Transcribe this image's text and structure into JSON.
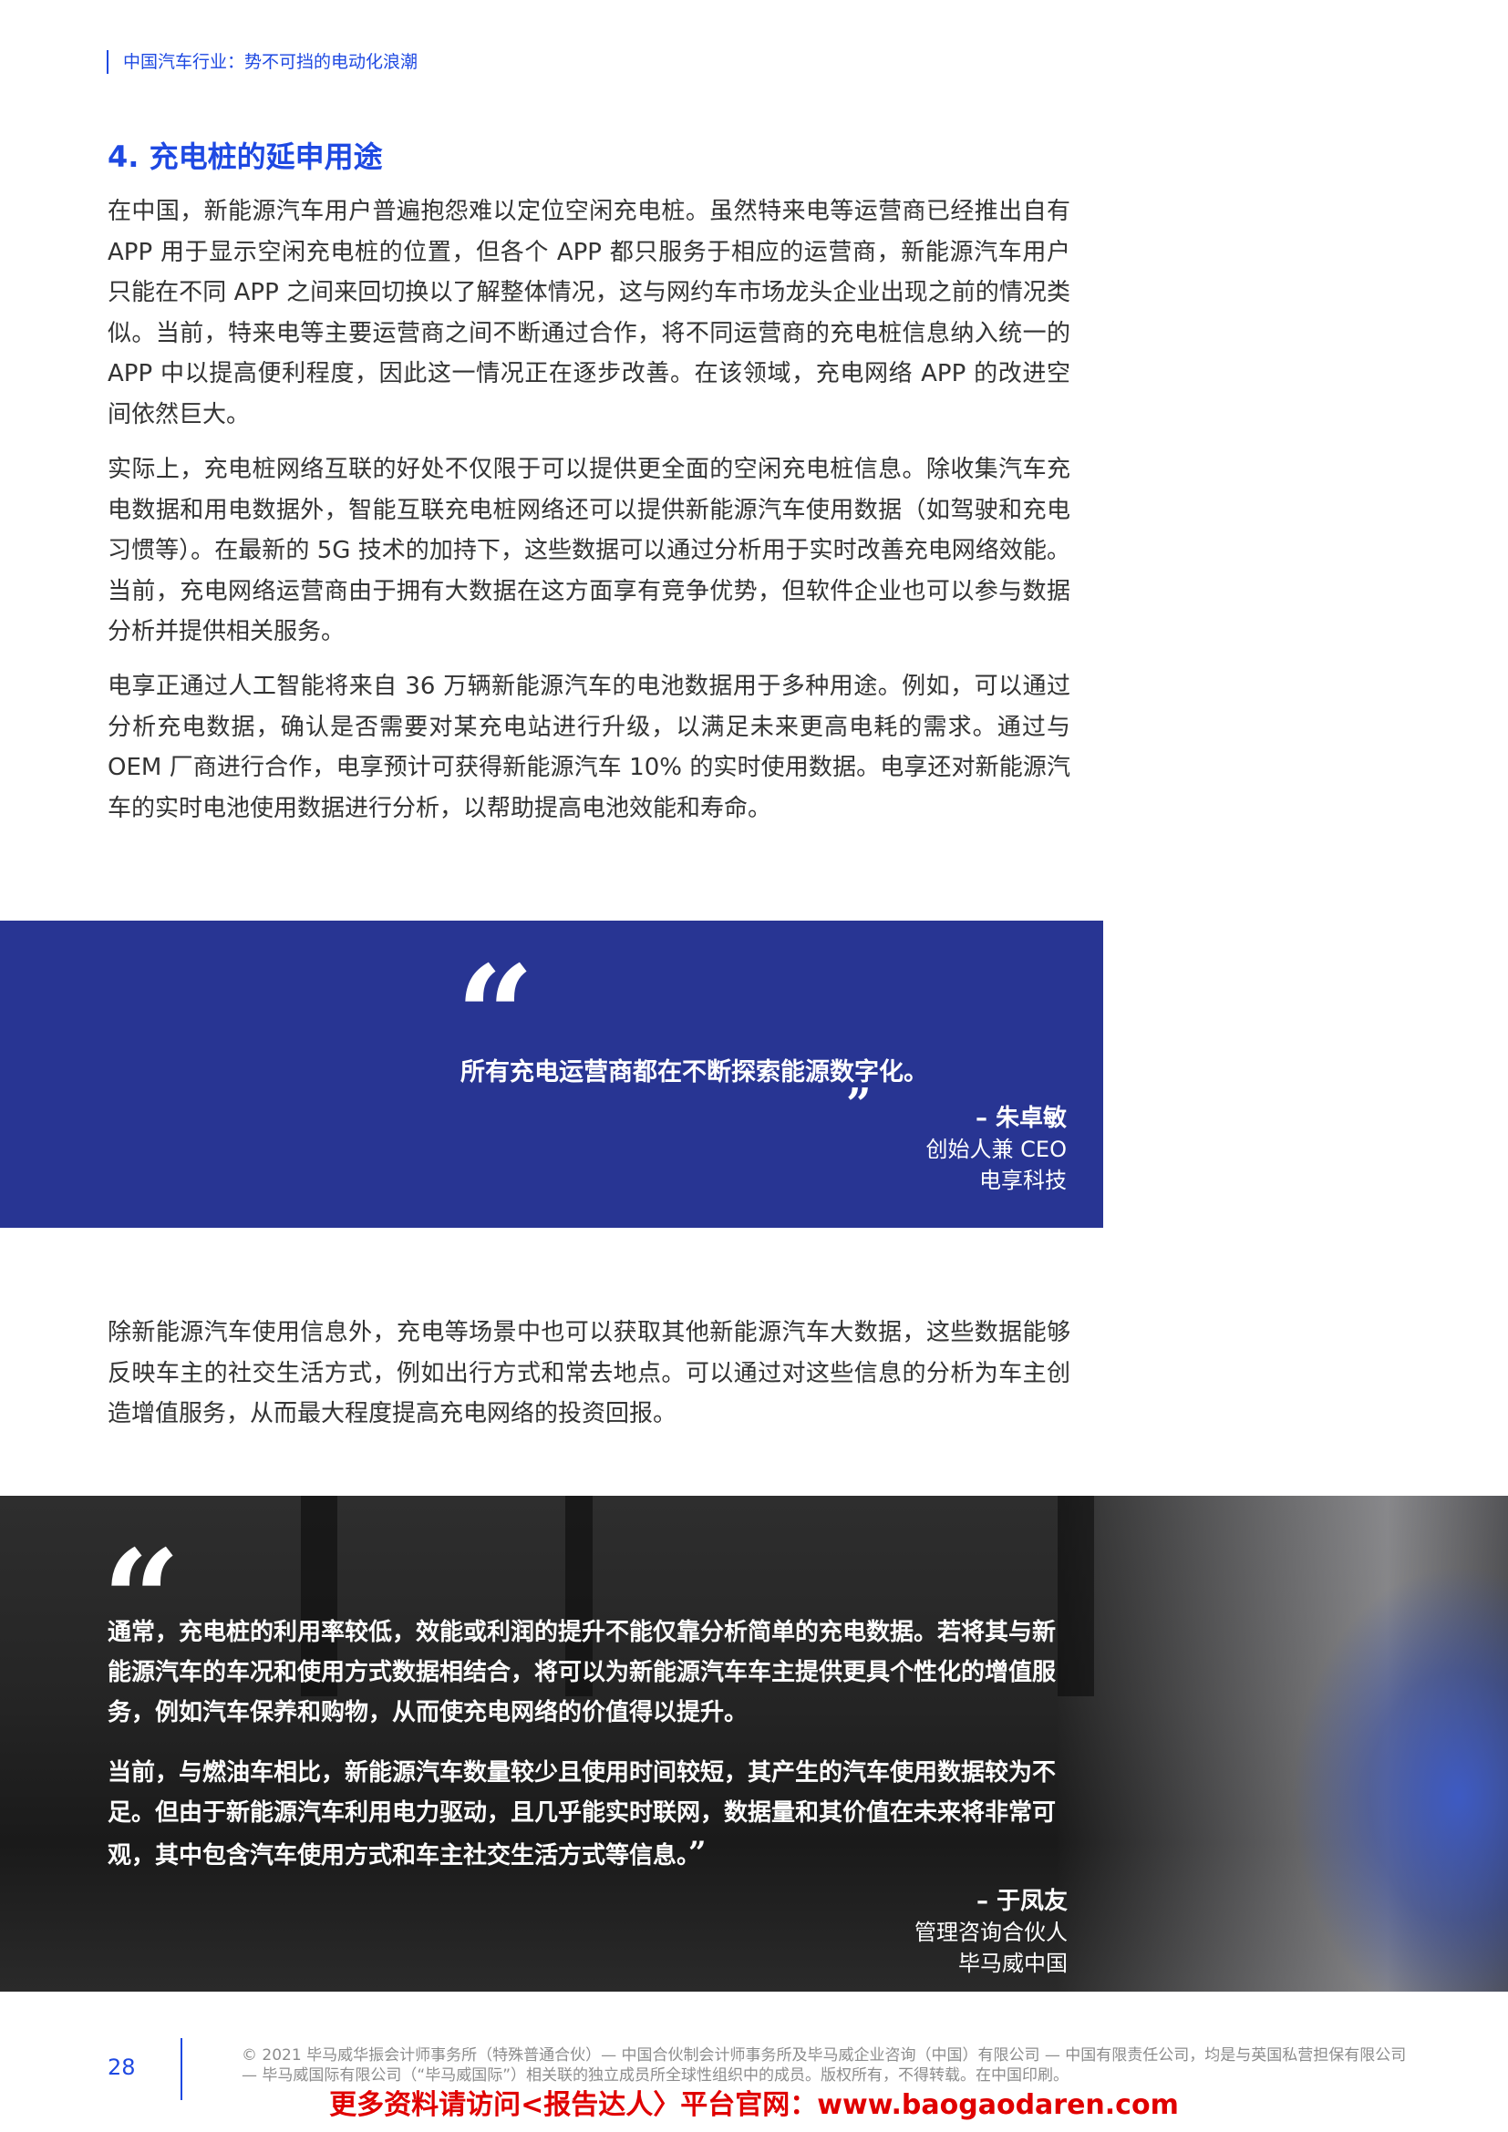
{
  "header": {
    "title": "中国汽车行业：势不可挡的电动化浪潮"
  },
  "section": {
    "title": "4. 充电桩的延申用途"
  },
  "paragraphs": [
    "在中国，新能源汽车用户普遍抱怨难以定位空闲充电桩。虽然特来电等运营商已经推出自有 APP 用于显示空闲充电桩的位置，但各个 APP 都只服务于相应的运营商，新能源汽车用户只能在不同 APP 之间来回切换以了解整体情况，这与网约车市场龙头企业出现之前的情况类似。当前，特来电等主要运营商之间不断通过合作，将不同运营商的充电桩信息纳入统一的 APP 中以提高便利程度，因此这一情况正在逐步改善。在该领域，充电网络 APP 的改进空间依然巨大。",
    "实际上，充电桩网络互联的好处不仅限于可以提供更全面的空闲充电桩信息。除收集汽车充电数据和用电数据外，智能互联充电桩网络还可以提供新能源汽车使用数据（如驾驶和充电习惯等）。在最新的 5G 技术的加持下，这些数据可以通过分析用于实时改善充电网络效能。当前，充电网络运营商由于拥有大数据在这方面享有竞争优势，但软件企业也可以参与数据分析并提供相关服务。",
    "电享正通过人工智能将来自 36 万辆新能源汽车的电池数据用于多种用途。例如，可以通过分析充电数据，确认是否需要对某充电站进行升级，以满足未来更高电耗的需求。通过与 OEM 厂商进行合作，电享预计可获得新能源汽车 10% 的实时使用数据。电享还对新能源汽车的实时电池使用数据进行分析，以帮助提高电池效能和寿命。",
    "除新能源汽车使用信息外，充电等场景中也可以获取其他新能源汽车大数据，这些数据能够反映车主的社交生活方式，例如出行方式和常去地点。可以通过对这些信息的分析为车主创造增值服务，从而最大程度提高充电网络的投资回报。"
  ],
  "quote1": {
    "open_mark": "“",
    "text": "所有充电运营商都在不断探索能源数字化。",
    "close_mark": "”",
    "name": "– 朱卓敏",
    "title": "创始人兼 CEO",
    "company": "电享科技"
  },
  "quote2": {
    "open_mark": "“",
    "text1": "通常，充电桩的利用率较低，效能或利润的提升不能仅靠分析简单的充电数据。若将其与新能源汽车的车况和使用方式数据相结合，将可以为新能源汽车车主提供更具个性化的增值服务，例如汽车保养和购物，从而使充电网络的价值得以提升。",
    "text2": "当前，与燃油车相比，新能源汽车数量较少且使用时间较短，其产生的汽车使用数据较为不足。但由于新能源汽车利用电力驱动，且几乎能实时联网，数据量和其价值在未来将非常可观，其中包含汽车使用方式和车主社交生活方式等信息。",
    "close_mark": "”",
    "name": "– 于凤友",
    "title": "管理咨询合伙人",
    "company": "毕马威中国"
  },
  "footer": {
    "page_number": "28",
    "copyright": "© 2021 毕马威华振会计师事务所（特殊普通合伙）— 中国合伙制会计师事务所及毕马威企业咨询（中国）有限公司 — 中国有限责任公司，均是与英国私营担保有限公司 — 毕马威国际有限公司（“毕马威国际”）相关联的独立成员所全球性组织中的成员。版权所有，不得转载。在中国印刷。",
    "watermark": "更多资料请访问<报告达人〉平台官网：www.baogaodaren.com"
  },
  "colors": {
    "accent": "#1e49e2",
    "quote_bg": "#283593",
    "watermark": "#e00000"
  }
}
